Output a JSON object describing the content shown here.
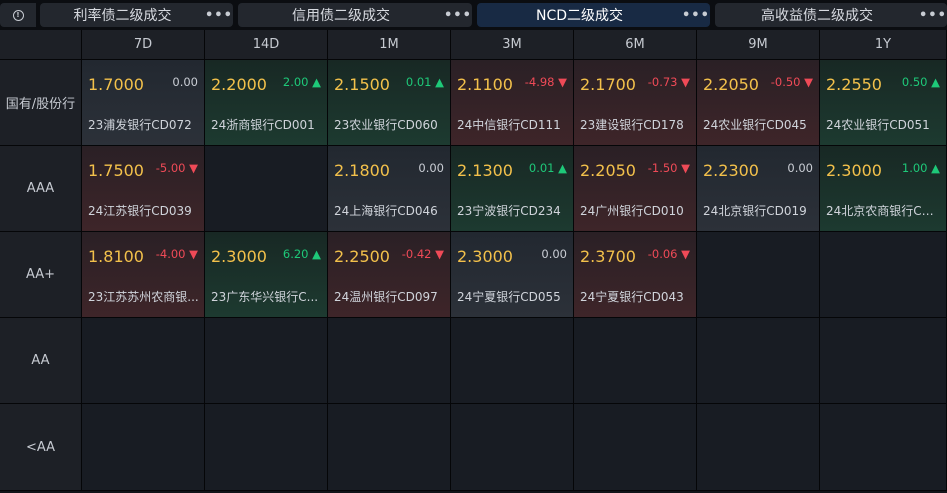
{
  "tabs": [
    {
      "label": "利率债二级成交",
      "more": "•••"
    },
    {
      "label": "信用债二级成交",
      "more": "•••"
    },
    {
      "label": "NCD二级成交",
      "more": "•••",
      "active": true
    },
    {
      "label": "高收益债二级成交",
      "more": "•••"
    }
  ],
  "info_icon": "info-icon",
  "columns": [
    "7D",
    "14D",
    "1M",
    "3M",
    "6M",
    "9M",
    "1Y"
  ],
  "rows": [
    {
      "label": "国有/股份行",
      "cells": [
        {
          "yield": "1.7000",
          "change": "0.00",
          "dir": "flat",
          "name": "23浦发银行CD072"
        },
        {
          "yield": "2.2000",
          "change": "2.00 ▲",
          "dir": "up",
          "name": "24浙商银行CD001"
        },
        {
          "yield": "2.1500",
          "change": "0.01 ▲",
          "dir": "up",
          "name": "23农业银行CD060"
        },
        {
          "yield": "2.1100",
          "change": "-4.98 ▼",
          "dir": "down",
          "name": "24中信银行CD111"
        },
        {
          "yield": "2.1700",
          "change": "-0.73 ▼",
          "dir": "down",
          "name": "23建设银行CD178"
        },
        {
          "yield": "2.2050",
          "change": "-0.50 ▼",
          "dir": "down",
          "name": "24农业银行CD045"
        },
        {
          "yield": "2.2550",
          "change": "0.50 ▲",
          "dir": "up",
          "name": "24农业银行CD051"
        }
      ]
    },
    {
      "label": "AAA",
      "cells": [
        {
          "yield": "1.7500",
          "change": "-5.00 ▼",
          "dir": "down",
          "name": "24江苏银行CD039"
        },
        null,
        {
          "yield": "2.1800",
          "change": "0.00",
          "dir": "flat",
          "name": "24上海银行CD046"
        },
        {
          "yield": "2.1300",
          "change": "0.01 ▲",
          "dir": "up",
          "name": "23宁波银行CD234"
        },
        {
          "yield": "2.2050",
          "change": "-1.50 ▼",
          "dir": "down",
          "name": "24广州银行CD010"
        },
        {
          "yield": "2.2300",
          "change": "0.00",
          "dir": "flat",
          "name": "24北京银行CD019"
        },
        {
          "yield": "2.3000",
          "change": "1.00 ▲",
          "dir": "up",
          "name": "24北京农商银行CD..."
        }
      ]
    },
    {
      "label": "AA+",
      "cells": [
        {
          "yield": "1.8100",
          "change": "-4.00 ▼",
          "dir": "down",
          "name": "23江苏苏州农商银..."
        },
        {
          "yield": "2.3000",
          "change": "6.20 ▲",
          "dir": "up",
          "name": "23广东华兴银行C..."
        },
        {
          "yield": "2.2500",
          "change": "-0.42 ▼",
          "dir": "down",
          "name": "24温州银行CD097"
        },
        {
          "yield": "2.3000",
          "change": "0.00",
          "dir": "flat",
          "name": "24宁夏银行CD055"
        },
        {
          "yield": "2.3700",
          "change": "-0.06 ▼",
          "dir": "down",
          "name": "24宁夏银行CD043"
        },
        null,
        null
      ]
    },
    {
      "label": "AA",
      "cells": [
        null,
        null,
        null,
        null,
        null,
        null,
        null
      ]
    },
    {
      "label": "<AA",
      "cells": [
        null,
        null,
        null,
        null,
        null,
        null,
        null
      ]
    }
  ],
  "colors": {
    "up": "#1ec979",
    "down": "#ef4a57",
    "yield": "#f3c14b",
    "active_tab": "#182a44"
  }
}
